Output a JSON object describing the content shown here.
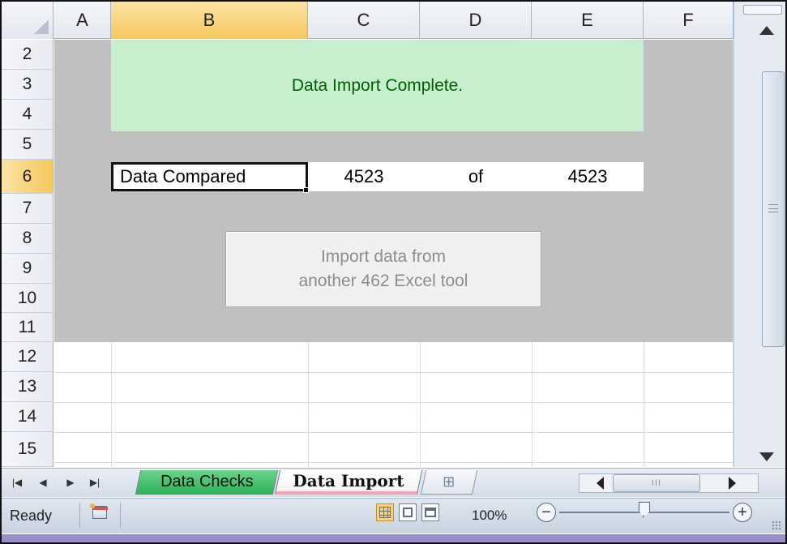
{
  "sheet": {
    "columns": [
      "A",
      "B",
      "C",
      "D",
      "E",
      "F"
    ],
    "selected_column": "B",
    "rows": [
      "2",
      "3",
      "4",
      "5",
      "6",
      "7",
      "8",
      "9",
      "10",
      "11",
      "12",
      "13",
      "14",
      "15"
    ],
    "selected_row": "6"
  },
  "content": {
    "banner_text": "Data Import Complete.",
    "row6": {
      "label": "Data Compared",
      "count": "4523",
      "of_word": "of",
      "total": "4523"
    },
    "import_button": {
      "line1": "Import data from",
      "line2": "another 462 Excel tool"
    },
    "banner_bg": "#c6efce",
    "banner_color": "#006100",
    "panel_bg": "#c0c0c0"
  },
  "tabs": {
    "items": [
      {
        "label": "Data Checks",
        "color": "#2eb159"
      },
      {
        "label": "Data Import",
        "active": true,
        "underline_color": "#f3a3b2"
      }
    ],
    "nav_icons": [
      "first-sheet-icon",
      "prev-sheet-icon",
      "next-sheet-icon",
      "last-sheet-icon"
    ],
    "new_sheet_icon": "insert-worksheet-icon"
  },
  "status": {
    "ready": "Ready",
    "zoom": "100%",
    "zoom_out": "−",
    "zoom_in": "+",
    "hscroll_grip": "III"
  }
}
